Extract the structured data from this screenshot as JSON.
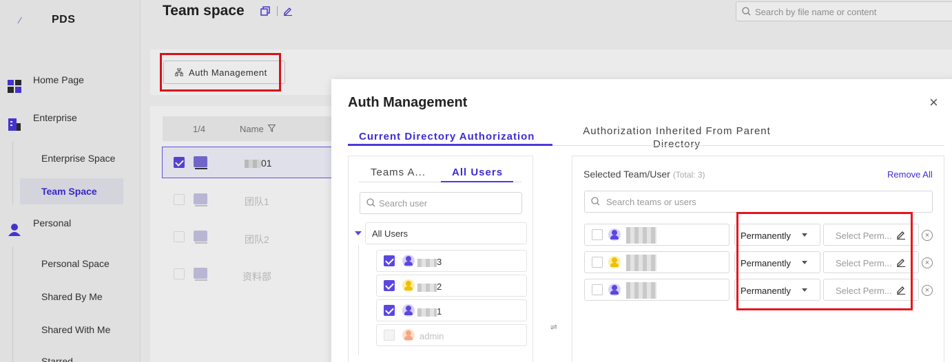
{
  "app": {
    "brand": "PDS"
  },
  "sidebar": {
    "items": [
      {
        "label": "Home Page"
      },
      {
        "label": "Enterprise"
      },
      {
        "label": "Enterprise Space"
      },
      {
        "label": "Team Space"
      },
      {
        "label": "Personal"
      },
      {
        "label": "Personal Space"
      },
      {
        "label": "Shared By Me"
      },
      {
        "label": "Shared With Me"
      },
      {
        "label": "Starred"
      }
    ]
  },
  "header": {
    "title": "Team space",
    "search_placeholder": "Search by file name or content"
  },
  "toolbar": {
    "auth_button": "Auth Management"
  },
  "table": {
    "page_indicator": "1/4",
    "name_header": "Name",
    "rows": [
      {
        "name_suffix": "01",
        "selected": true
      },
      {
        "name": "团队1"
      },
      {
        "name": "团队2"
      },
      {
        "name": "资料部"
      }
    ]
  },
  "modal": {
    "title": "Auth Management",
    "close": "×",
    "tabs": [
      {
        "label": "Current Directory Authorization",
        "active": true
      },
      {
        "label": "Authorization Inherited From Parent Directory",
        "active": false
      }
    ],
    "left": {
      "sub_tabs": [
        {
          "label": "Teams A...",
          "active": false
        },
        {
          "label": "All Users",
          "active": true
        }
      ],
      "search_placeholder": "Search user",
      "root": "All Users",
      "users": [
        {
          "name_suffix": "3",
          "checked": true,
          "avatar": "purple"
        },
        {
          "name_suffix": "2",
          "checked": true,
          "avatar": "yellow"
        },
        {
          "name_suffix": "1",
          "checked": true,
          "avatar": "purple"
        },
        {
          "name": "admin",
          "checked": false,
          "avatar": "orange",
          "disabled": true
        }
      ]
    },
    "transfer_icon": "⇌",
    "right": {
      "title": "Selected Team/User",
      "total": "(Total: 3)",
      "remove_all": "Remove All",
      "search_placeholder": "Search teams or users",
      "rows": [
        {
          "avatar": "purple",
          "duration": "Permanently",
          "permission_placeholder": "Select Perm..."
        },
        {
          "avatar": "yellow",
          "duration": "Permanently",
          "permission_placeholder": "Select Perm..."
        },
        {
          "avatar": "purple",
          "duration": "Permanently",
          "permission_placeholder": "Select Perm..."
        }
      ]
    }
  },
  "colors": {
    "accent": "#4b38e0",
    "highlight": "#e8141e"
  }
}
